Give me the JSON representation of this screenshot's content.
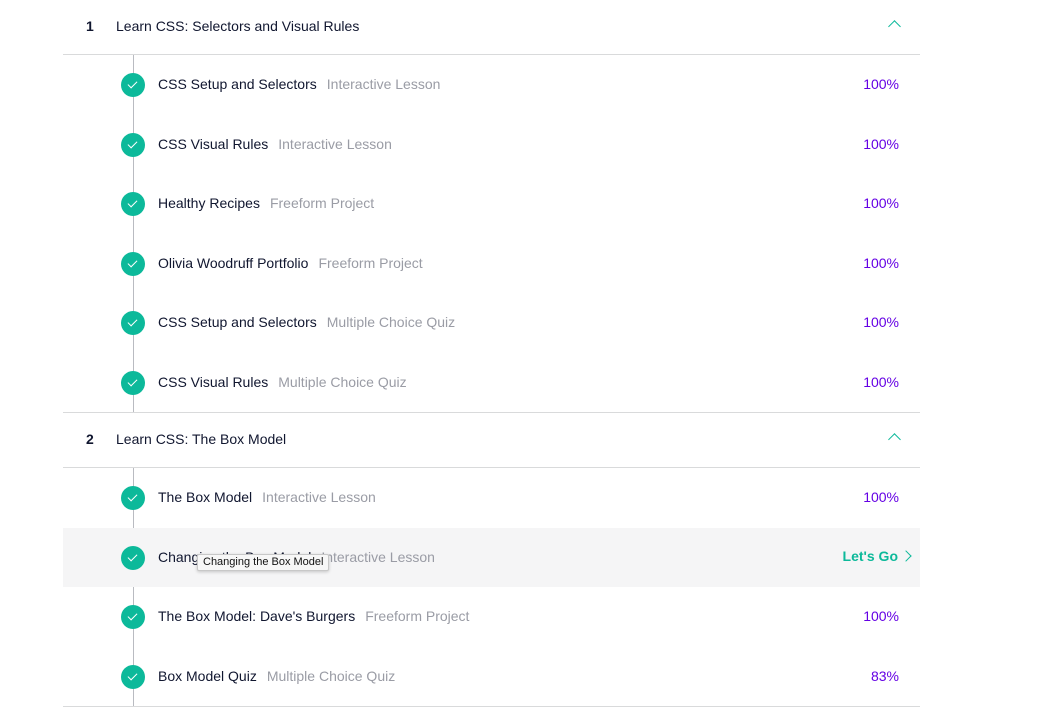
{
  "modules": [
    {
      "number": "1",
      "title": "Learn CSS: Selectors and Visual Rules",
      "lessons": [
        {
          "name": "CSS Setup and Selectors",
          "type": "Interactive Lesson",
          "progress": "100%"
        },
        {
          "name": "CSS Visual Rules",
          "type": "Interactive Lesson",
          "progress": "100%"
        },
        {
          "name": "Healthy Recipes",
          "type": "Freeform Project",
          "progress": "100%"
        },
        {
          "name": "Olivia Woodruff Portfolio",
          "type": "Freeform Project",
          "progress": "100%"
        },
        {
          "name": "CSS Setup and Selectors",
          "type": "Multiple Choice Quiz",
          "progress": "100%"
        },
        {
          "name": "CSS Visual Rules",
          "type": "Multiple Choice Quiz",
          "progress": "100%"
        }
      ]
    },
    {
      "number": "2",
      "title": "Learn CSS: The Box Model",
      "lessons": [
        {
          "name": "The Box Model",
          "type": "Interactive Lesson",
          "progress": "100%"
        },
        {
          "name": "Changing the Box Model",
          "type": "Interactive Lesson",
          "action": "Let's Go"
        },
        {
          "name": "The Box Model: Dave's Burgers",
          "type": "Freeform Project",
          "progress": "100%"
        },
        {
          "name": "Box Model Quiz",
          "type": "Multiple Choice Quiz",
          "progress": "83%"
        }
      ]
    }
  ],
  "tooltip": "Changing the Box Model",
  "colors": {
    "accent": "#0cb99a",
    "progress": "#6400e4",
    "text": "#10162f",
    "muted": "#9a9ca5"
  },
  "icons": {
    "complete": "check-circle-icon",
    "collapse": "chevron-up-icon",
    "go": "chevron-right-icon"
  }
}
